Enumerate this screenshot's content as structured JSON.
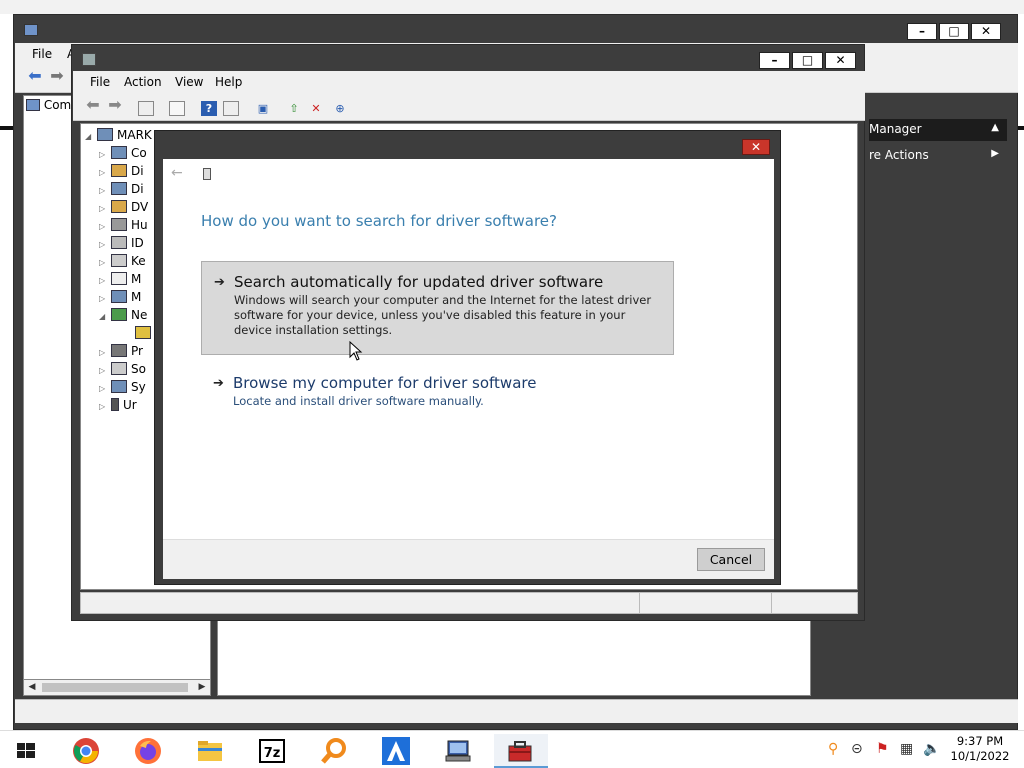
{
  "outer_window": {
    "menu": [
      "File",
      "A"
    ],
    "tree_top_label": "Com",
    "actions_heading": "Manager",
    "actions_more": "re Actions"
  },
  "device_manager": {
    "menu": [
      "File",
      "Action",
      "View",
      "Help"
    ],
    "tree": [
      "MARK",
      "Co",
      "Di",
      "Di",
      "DV",
      "Hu",
      "ID",
      "Ke",
      "M",
      "M",
      "Ne",
      "Pr",
      "So",
      "Sy",
      "Ur"
    ]
  },
  "dialog": {
    "heading": "How do you want to search for driver software?",
    "option1": {
      "title": "Search automatically for updated driver software",
      "description": "Windows will search your computer and the Internet for the latest driver software for your device, unless you've disabled this feature in your device installation settings."
    },
    "option2": {
      "title": "Browse my computer for driver software",
      "description": "Locate and install driver software manually."
    },
    "cancel_label": "Cancel"
  },
  "taskbar": {
    "time": "9:37 PM",
    "date": "10/1/2022",
    "apps": [
      "start-icon",
      "chrome-icon",
      "firefox-icon",
      "file-explorer-icon",
      "7zip-icon",
      "search-tool-icon",
      "a-app-icon",
      "computer-management-icon",
      "toolbox-icon"
    ]
  },
  "colors": {
    "heading_blue": "#3a7fae",
    "option_hover": "#d9d9d9",
    "close_red": "#c9352a",
    "chrome_dark": "#3d3d3d"
  }
}
